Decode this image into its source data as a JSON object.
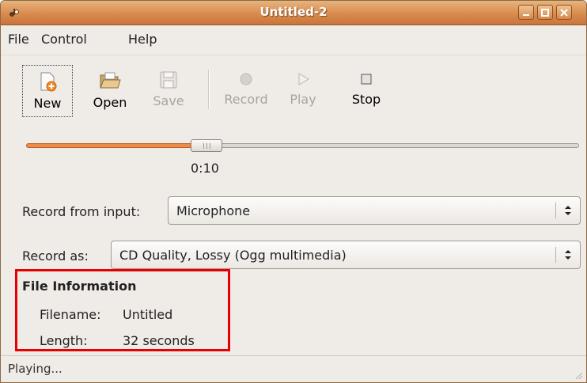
{
  "window": {
    "title": "Untitled-2"
  },
  "menu": {
    "items": [
      "File",
      "Control",
      "Help"
    ]
  },
  "toolbar": {
    "new": "New",
    "open": "Open",
    "save": "Save",
    "record": "Record",
    "play": "Play",
    "stop": "Stop"
  },
  "slider": {
    "time": "0:10",
    "position_fraction": 0.34
  },
  "record_from": {
    "label": "Record from input:",
    "value": "Microphone"
  },
  "record_as": {
    "label": "Record as:",
    "value": "CD Quality, Lossy (Ogg multimedia)"
  },
  "file_info": {
    "title": "File Information",
    "filename_label": "Filename:",
    "filename_value": "Untitled",
    "length_label": "Length:",
    "length_value": "32 seconds"
  },
  "status": {
    "text": "Playing..."
  },
  "colors": {
    "titlebar": "#d98b4e",
    "progress": "#ee8a4a",
    "highlight": "#e60000"
  }
}
